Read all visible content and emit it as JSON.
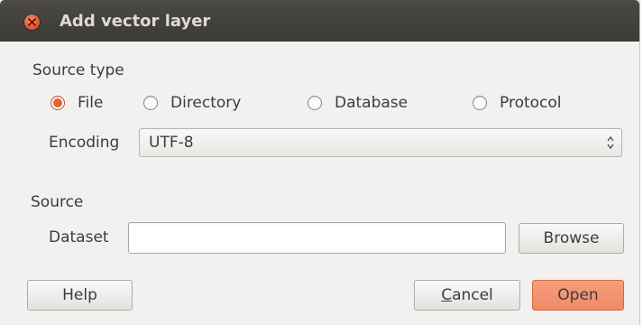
{
  "window": {
    "title": "Add vector layer"
  },
  "source_type": {
    "label": "Source type",
    "options": [
      {
        "label": "File",
        "checked": true
      },
      {
        "label": "Directory",
        "checked": false
      },
      {
        "label": "Database",
        "checked": false
      },
      {
        "label": "Protocol",
        "checked": false
      }
    ],
    "encoding_label": "Encoding",
    "encoding_value": "UTF-8"
  },
  "source": {
    "label": "Source",
    "dataset_label": "Dataset",
    "dataset_value": "",
    "browse_label": "Browse"
  },
  "buttons": {
    "help_label": "Help",
    "cancel_mnemonic": "C",
    "cancel_rest": "ancel",
    "open_label": "Open"
  },
  "colors": {
    "titlebar": "#3f3e3a",
    "accent": "#e8602d",
    "primary_button": "#f2926d",
    "dialog_background": "#f2f1f0"
  }
}
